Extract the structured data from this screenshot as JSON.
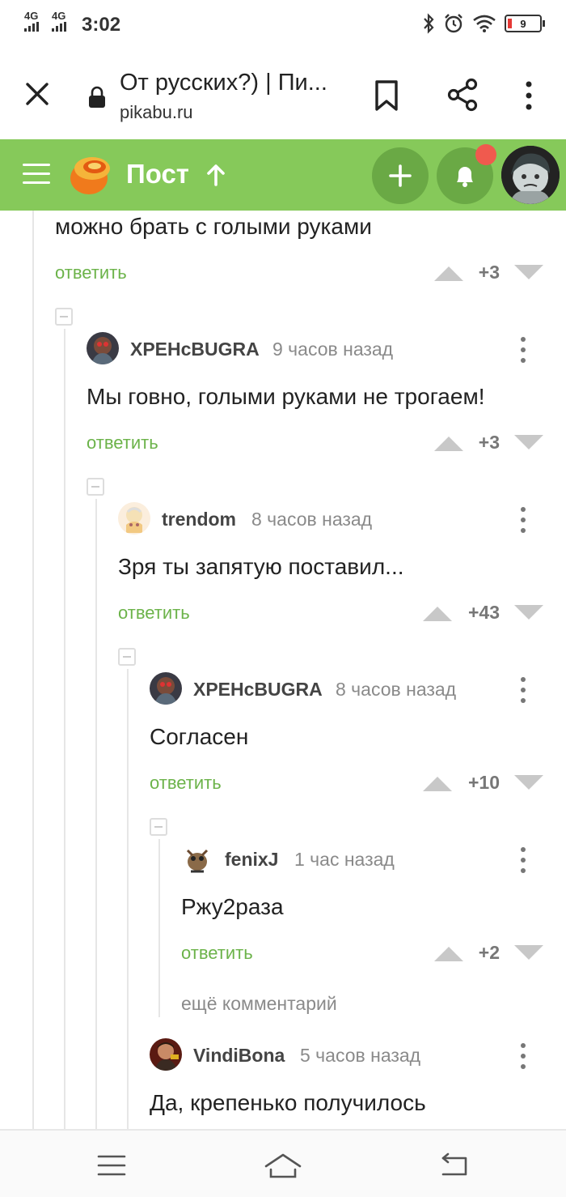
{
  "status": {
    "signal1": "4G",
    "signal2": "4G",
    "time": "3:02",
    "battery": "9"
  },
  "browser": {
    "title": "От русских?) | Пи...",
    "url": "pikabu.ru",
    "close_icon": "close-icon",
    "bookmark_icon": "bookmark-icon",
    "share_icon": "share-icon",
    "menu_icon": "more-vertical-icon"
  },
  "header": {
    "title": "Пост",
    "accent": "#86c95a",
    "button_color": "#6aa945",
    "notification_color": "#f05a4e"
  },
  "comments": [
    {
      "text": "можно брать с голыми руками",
      "reply": "ответить",
      "score": "+3"
    },
    {
      "author": "XPEHcBUGRA",
      "time": "9 часов назад",
      "text": "Мы говно, голыми руками не трогаем!",
      "reply": "ответить",
      "score": "+3"
    },
    {
      "author": "trendom",
      "time": "8 часов назад",
      "text": "Зря ты запятую поставил...",
      "reply": "ответить",
      "score": "+43"
    },
    {
      "author": "XPEHcBUGRA",
      "time": "8 часов назад",
      "text": "Согласен",
      "reply": "ответить",
      "score": "+10"
    },
    {
      "author": "fenixJ",
      "time": "1 час назад",
      "text": "Ржу2раза",
      "reply": "ответить",
      "score": "+2"
    },
    {
      "author": "VindiBona",
      "time": "5 часов назад",
      "text": "Да, крепенько получилось"
    }
  ],
  "more_comments": "ещё комментарий",
  "nav": {
    "menu_icon": "menu-icon",
    "home_icon": "home-icon",
    "back_icon": "back-icon"
  }
}
